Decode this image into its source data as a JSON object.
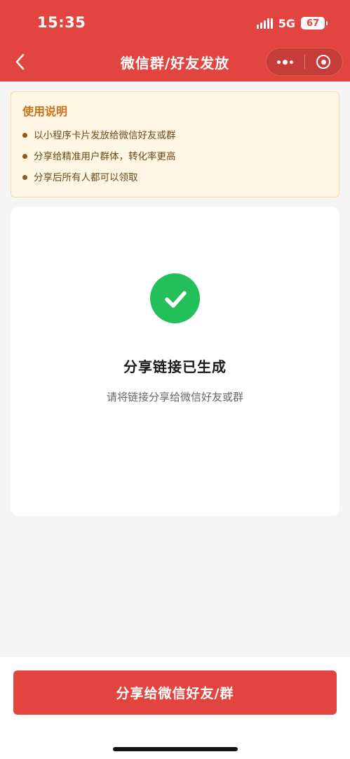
{
  "status": {
    "time": "15:35",
    "network": "5G",
    "battery": "67"
  },
  "nav": {
    "title": "微信群/好友发放",
    "back_icon": "chevron-left-icon",
    "more_icon": "more-dots-icon",
    "close_icon": "target-circle-icon"
  },
  "notice": {
    "title": "使用说明",
    "items": [
      "以小程序卡片发放给微信好友或群",
      "分享给精准用户群体，转化率更高",
      "分享后所有人都可以领取"
    ]
  },
  "result": {
    "icon": "check-circle-icon",
    "title": "分享链接已生成",
    "subtitle": "请将链接分享给微信好友或群"
  },
  "action": {
    "share_label": "分享给微信好友/群"
  },
  "colors": {
    "brand_red": "#e24540",
    "success_green": "#22bf5a",
    "notice_bg": "#fff6e4",
    "notice_title": "#c8731a"
  }
}
